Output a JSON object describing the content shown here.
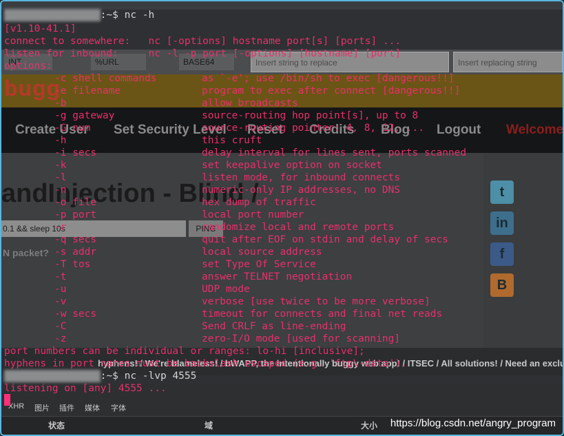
{
  "background_page": {
    "toolbar": {
      "select_left": "INT",
      "select_url": "%URL",
      "select_b64": "BASE64",
      "input_replace": "Insert string to replace",
      "input_replacing": "Insert replacing string"
    },
    "banner_text": "bugg",
    "nav": [
      "Create User",
      "Set Security Level",
      "Reset",
      "Credits",
      "Blog",
      "Logout",
      "Welcome"
    ],
    "title": "andInjection - Blind /",
    "field_value": "0.1 && sleep 10s",
    "field_button": "PING",
    "question": "N packet?",
    "social_icons": [
      "twitter-icon",
      "linkedin-icon",
      "facebook-icon",
      "blogger-icon"
    ],
    "footer_text": "hyphens! / We're blameless! / bWAPP, the intentionally buggy web app! / ITSEC / All solutions! / Need an exclusive s",
    "devtools_tabs": [
      "XHR",
      "图片",
      "插件",
      "媒体",
      "字体"
    ],
    "devtools_cols": [
      "状态",
      "域",
      "大小"
    ]
  },
  "terminal": {
    "prompt1_cmd": ":~$ nc -h",
    "version": "[v1.10-41.1]",
    "connect": "connect to somewhere:   nc [-options] hostname port[s] [ports] ...",
    "listen": "listen for inbound:     nc -l -p port [-options] [hostname] [port]",
    "options_label": "options:",
    "options": [
      {
        "flag": "-c shell commands",
        "desc": "as `-e'; use /bin/sh to exec [dangerous!!]"
      },
      {
        "flag": "-e filename",
        "desc": "program to exec after connect [dangerous!!]"
      },
      {
        "flag": "-b",
        "desc": "allow broadcasts"
      },
      {
        "flag": "-g gateway",
        "desc": "source-routing hop point[s], up to 8"
      },
      {
        "flag": "-G num",
        "desc": "source-routing pointer: 4, 8, 12, ..."
      },
      {
        "flag": "-h",
        "desc": "this cruft"
      },
      {
        "flag": "-i secs",
        "desc": "delay interval for lines sent, ports scanned"
      },
      {
        "flag": "-k",
        "desc": "set keepalive option on socket"
      },
      {
        "flag": "-l",
        "desc": "listen mode, for inbound connects"
      },
      {
        "flag": "-n",
        "desc": "numeric-only IP addresses, no DNS"
      },
      {
        "flag": "-o file",
        "desc": "hex dump of traffic"
      },
      {
        "flag": "-p port",
        "desc": "local port number"
      },
      {
        "flag": "-r",
        "desc": "randomize local and remote ports"
      },
      {
        "flag": "-q secs",
        "desc": "quit after EOF on stdin and delay of secs"
      },
      {
        "flag": "-s addr",
        "desc": "local source address"
      },
      {
        "flag": "-T tos",
        "desc": "set Type Of Service"
      },
      {
        "flag": "-t",
        "desc": "answer TELNET negotiation"
      },
      {
        "flag": "-u",
        "desc": "UDP mode"
      },
      {
        "flag": "-v",
        "desc": "verbose [use twice to be more verbose]"
      },
      {
        "flag": "-w secs",
        "desc": "timeout for connects and final net reads"
      },
      {
        "flag": "-C",
        "desc": "Send CRLF as line-ending"
      },
      {
        "flag": "-z",
        "desc": "zero-I/O mode [used for scanning]"
      }
    ],
    "footer1": "port numbers can be individual or ranges: lo-hi [inclusive];",
    "footer2": "hyphens in port names must be backslash escaped (e.g. 'ftp\\-data').",
    "prompt2_cmd": ":~$ nc -lvp 4555",
    "listening": "listening on [any] 4555 ..."
  },
  "watermark": "https://blog.csdn.net/angry_program"
}
